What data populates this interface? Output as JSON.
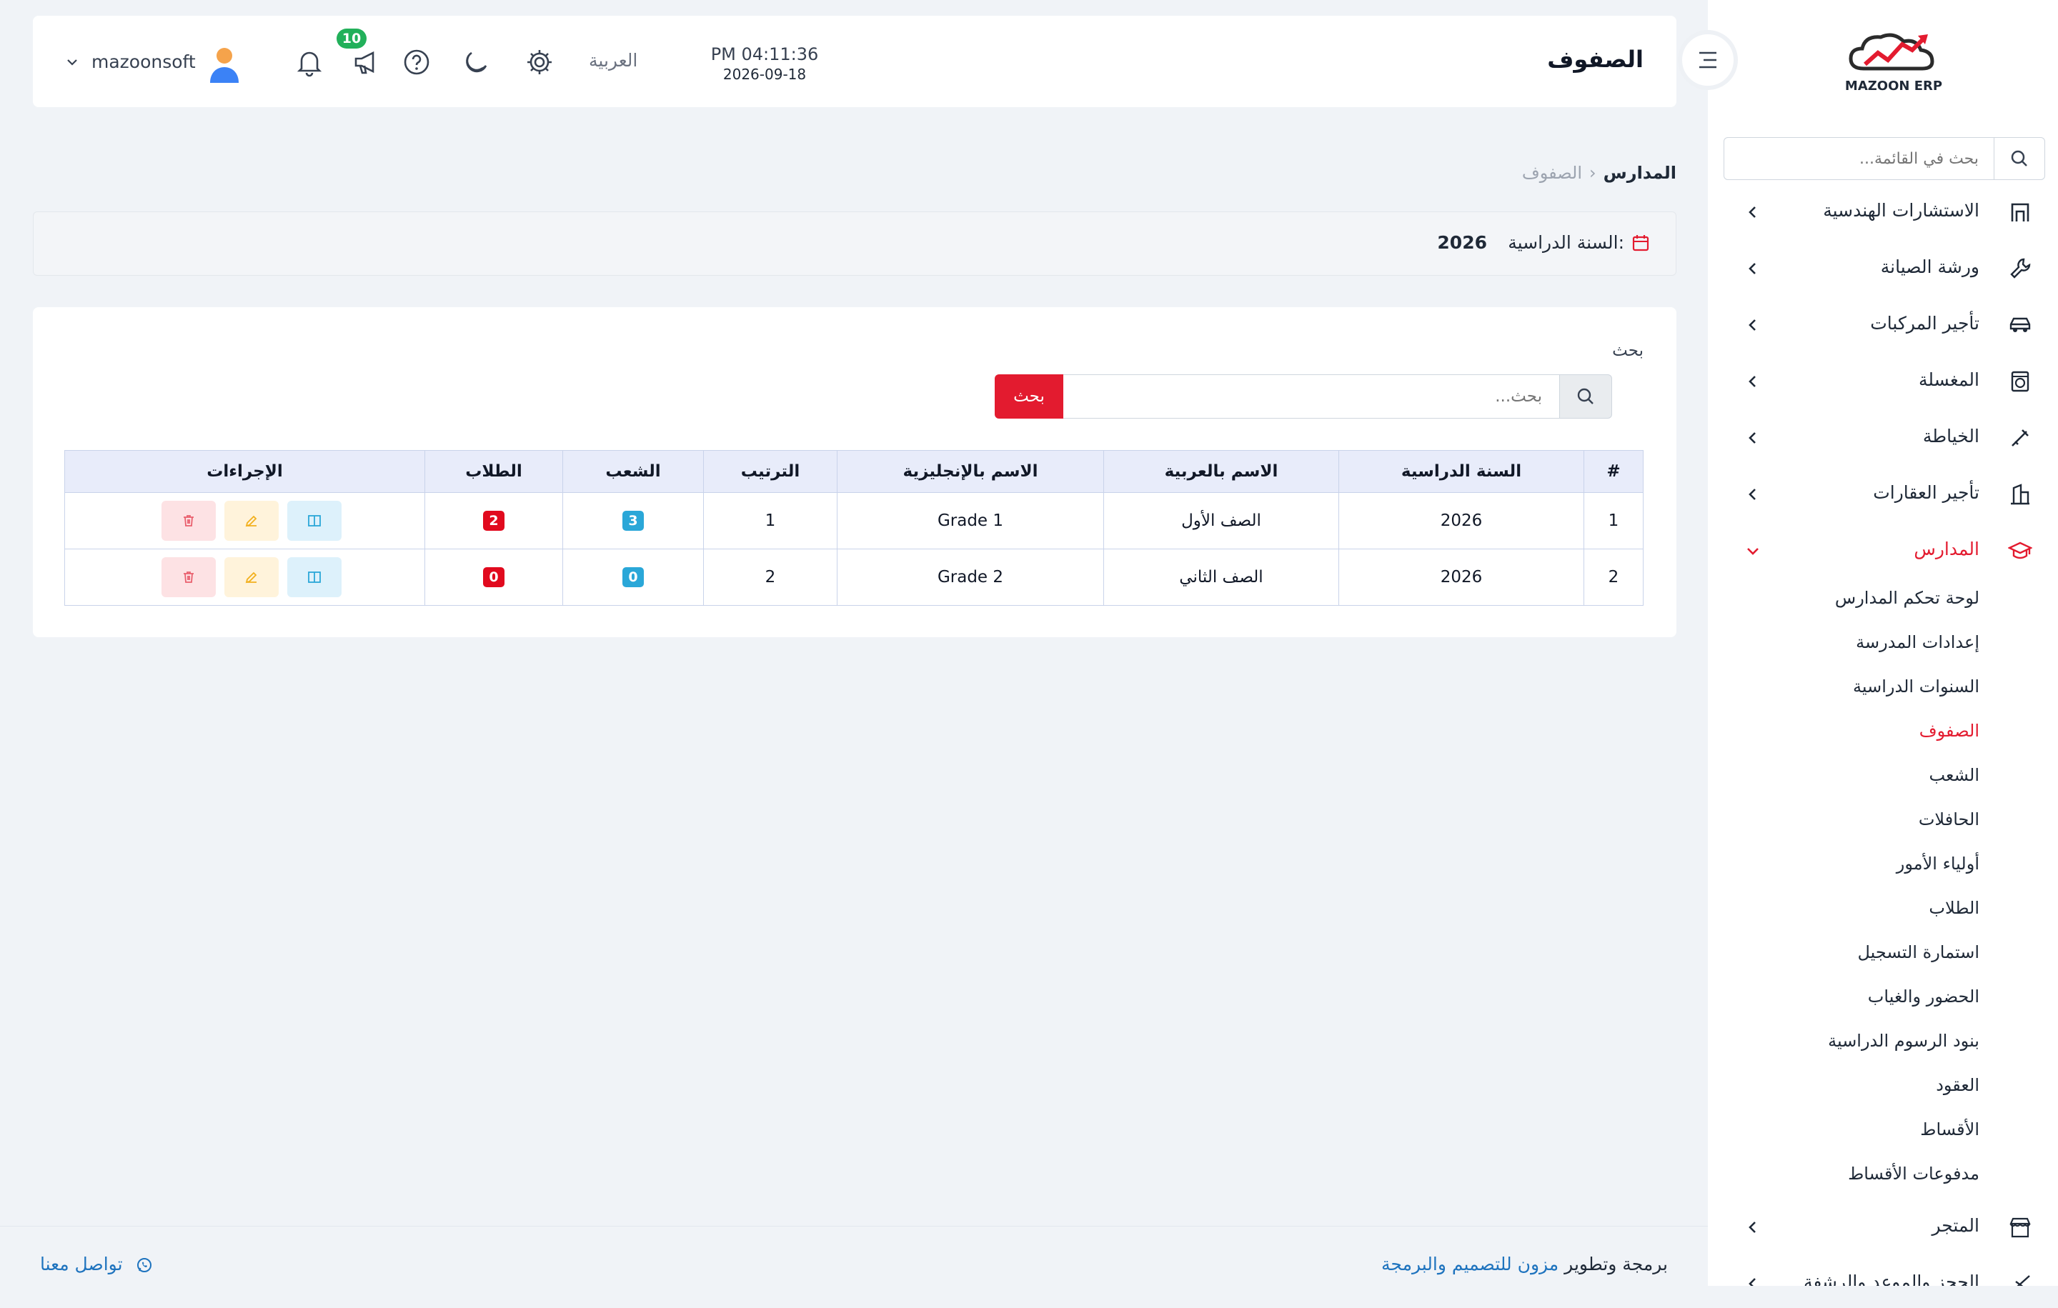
{
  "sidebar": {
    "logo_text": "MAZOON ERP",
    "search_placeholder": "بحث في القائمة...",
    "items": [
      {
        "label": "الاستشارات الهندسية",
        "icon": "building-icon"
      },
      {
        "label": "ورشة الصيانة",
        "icon": "wrench-icon"
      },
      {
        "label": "تأجير المركبات",
        "icon": "car-icon"
      },
      {
        "label": "المغسلة",
        "icon": "washer-icon"
      },
      {
        "label": "الخياطة",
        "icon": "needle-icon"
      },
      {
        "label": "تأجير العقارات",
        "icon": "apartment-icon"
      },
      {
        "label": "المدارس",
        "icon": "graduation-cap-icon",
        "active": true
      },
      {
        "label": "المتجر",
        "icon": "store-icon"
      },
      {
        "label": "الحجز والموعد والرشفة",
        "icon": "scissors-icon"
      }
    ],
    "schools_submenu": [
      "لوحة تحكم المدارس",
      "إعدادات المدرسة",
      "السنوات الدراسية",
      "الصفوف",
      "الشعب",
      "الحافلات",
      "أولياء الأمور",
      "الطلاب",
      "استمارة التسجيل",
      "الحضور والغياب",
      "بنود الرسوم الدراسية",
      "العقود",
      "الأقساط",
      "مدفوعات الأقساط"
    ],
    "active_subitem": "الصفوف"
  },
  "header": {
    "title": "الصفوف",
    "time": "PM 04:11:36",
    "date": "2026-09-18",
    "language": "العربية",
    "notification_count": "10",
    "username": "mazoonsoft"
  },
  "breadcrumb": {
    "parent": "المدارس",
    "current": "الصفوف"
  },
  "academic_year": {
    "label": "السنة الدراسية:",
    "value": "2026"
  },
  "search": {
    "label": "بحث",
    "placeholder": "بحث...",
    "button": "بحث"
  },
  "table": {
    "headers": [
      "#",
      "السنة الدراسية",
      "الاسم بالعربية",
      "الاسم بالإنجليزية",
      "الترتيب",
      "الشعب",
      "الطلاب",
      "الإجراءات"
    ],
    "rows": [
      {
        "num": "1",
        "year": "2026",
        "name_ar": "الصف الأول",
        "name_en": "Grade 1",
        "order": "1",
        "sections": "3",
        "students": "2"
      },
      {
        "num": "2",
        "year": "2026",
        "name_ar": "الصف الثاني",
        "name_en": "Grade 2",
        "order": "2",
        "sections": "0",
        "students": "0"
      }
    ]
  },
  "footer": {
    "credit_prefix": "برمجة وتطوير",
    "credit_brand": "مزون للتصميم والبرمجة",
    "contact": "تواصل معنا"
  },
  "colors": {
    "accent": "#e31b2f",
    "link": "#1e73be",
    "badge_green": "#22b05a",
    "pill_blue": "#2aa7d8",
    "pill_red": "#e10a1e"
  }
}
